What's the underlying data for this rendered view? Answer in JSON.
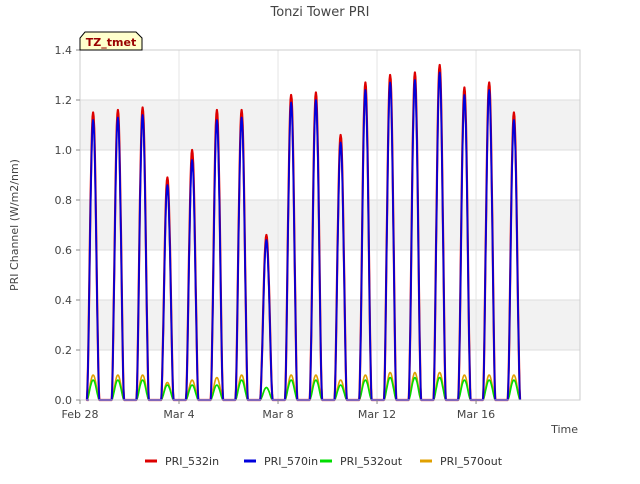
{
  "chart_data": {
    "type": "line",
    "title": "Tonzi Tower PRI",
    "xlabel": "Time",
    "ylabel": "PRI Channel (W/m2/nm)",
    "site_tag": "TZ_tmet",
    "xlim": [
      0,
      20.2
    ],
    "ylim": [
      0,
      1.4
    ],
    "x_ticks": [
      {
        "value": 0,
        "label": "Feb 28"
      },
      {
        "value": 4,
        "label": "Mar 4"
      },
      {
        "value": 8,
        "label": "Mar 8"
      },
      {
        "value": 12,
        "label": "Mar 12"
      },
      {
        "value": 16,
        "label": "Mar 16"
      }
    ],
    "y_ticks": [
      0.0,
      0.2,
      0.4,
      0.6,
      0.8,
      1.0,
      1.2,
      1.4
    ],
    "y_tick_labels": [
      "0.0",
      "0.2",
      "0.4",
      "0.6",
      "0.8",
      "1.0",
      "1.2",
      "1.4"
    ],
    "grid": true,
    "band_shading": true,
    "legend_position": "bottom",
    "series": [
      {
        "name": "PRI_532in",
        "color": "#dd0000"
      },
      {
        "name": "PRI_570in",
        "color": "#0000dd"
      },
      {
        "name": "PRI_532out",
        "color": "#00dd00"
      },
      {
        "name": "PRI_570out",
        "color": "#e0a000"
      }
    ],
    "daily_peaks": {
      "day": [
        1,
        2,
        3,
        4,
        5,
        6,
        7,
        8,
        9,
        10,
        11,
        12,
        13,
        14,
        15,
        16,
        17,
        18
      ],
      "PRI_532in": [
        1.15,
        1.16,
        1.17,
        0.89,
        1.0,
        1.16,
        1.16,
        0.66,
        1.22,
        1.23,
        1.06,
        1.27,
        1.3,
        1.31,
        1.34,
        1.25,
        1.27,
        1.15
      ],
      "PRI_570in": [
        1.12,
        1.13,
        1.14,
        0.86,
        0.96,
        1.12,
        1.13,
        0.64,
        1.19,
        1.2,
        1.03,
        1.24,
        1.27,
        1.28,
        1.31,
        1.22,
        1.24,
        1.12
      ],
      "PRI_532out": [
        0.08,
        0.08,
        0.08,
        0.06,
        0.06,
        0.06,
        0.08,
        0.05,
        0.08,
        0.08,
        0.06,
        0.08,
        0.09,
        0.09,
        0.09,
        0.08,
        0.08,
        0.08
      ],
      "PRI_570out": [
        0.1,
        0.1,
        0.1,
        0.07,
        0.08,
        0.09,
        0.1,
        0.05,
        0.1,
        0.1,
        0.08,
        0.1,
        0.11,
        0.11,
        0.11,
        0.1,
        0.1,
        0.1
      ]
    }
  }
}
